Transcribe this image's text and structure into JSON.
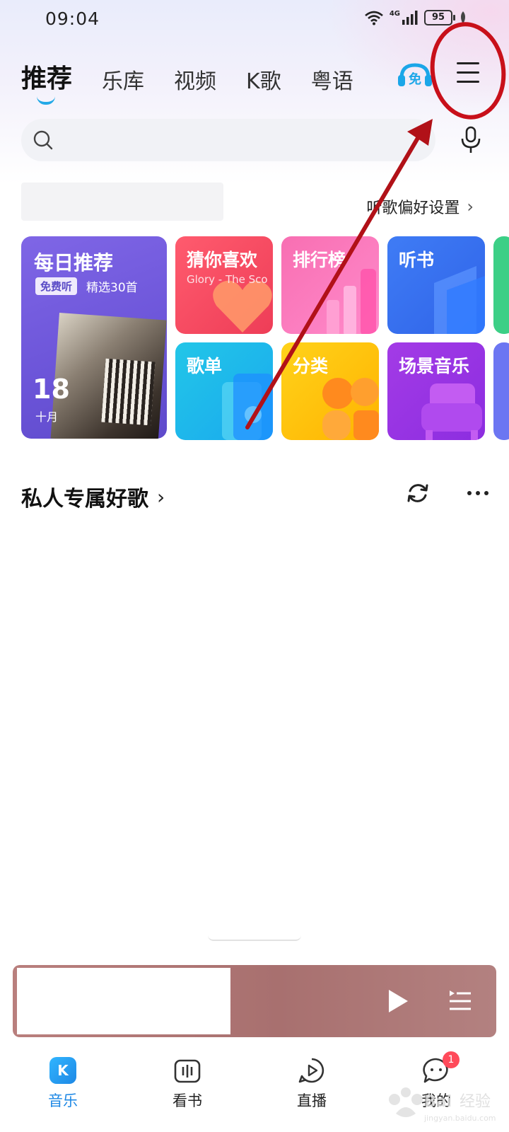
{
  "status_bar": {
    "time": "09:04",
    "network": "4G",
    "battery": "95"
  },
  "tabs": [
    {
      "label": "推荐",
      "active": true
    },
    {
      "label": "乐库"
    },
    {
      "label": "视频"
    },
    {
      "label": "K歌"
    },
    {
      "label": "粤语"
    }
  ],
  "header": {
    "free_badge_text": "免",
    "menu_icon": "hamburger-menu-icon"
  },
  "search": {
    "placeholder": "",
    "mic_icon": "mic-icon"
  },
  "preference_link": "听歌偏好设置",
  "cards": {
    "daily": {
      "title": "每日推荐",
      "tag": "免费听",
      "subtitle": "精选30首",
      "day": "18",
      "month": "十月"
    },
    "guess": {
      "title": "猜你喜欢",
      "subtitle": "Glory - The Sco"
    },
    "rank": {
      "title": "排行榜"
    },
    "book": {
      "title": "听书"
    },
    "playlist": {
      "title": "歌单"
    },
    "category": {
      "title": "分类"
    },
    "scene": {
      "title": "场景音乐"
    }
  },
  "section": {
    "title": "私人专属好歌"
  },
  "bottom_nav": [
    {
      "label": "音乐",
      "icon": "K",
      "active": true
    },
    {
      "label": "看书"
    },
    {
      "label": "直播"
    },
    {
      "label": "我的",
      "badge": "1"
    }
  ],
  "colors": {
    "accent": "#1e88e5",
    "annotation": "#d0121b",
    "player": "#a8706f"
  }
}
